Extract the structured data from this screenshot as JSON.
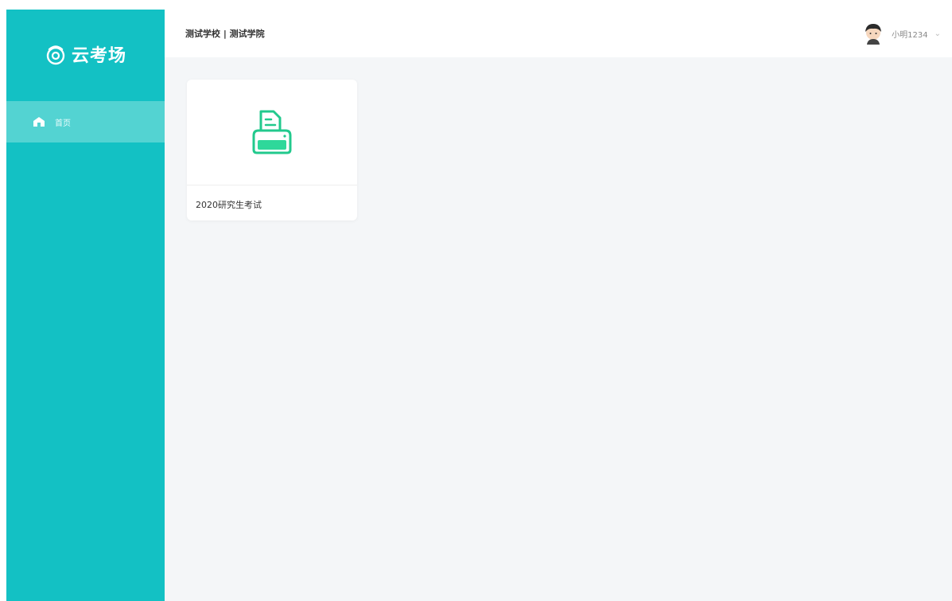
{
  "app": {
    "name": "云考场"
  },
  "sidebar": {
    "items": [
      {
        "label": "首页",
        "icon": "home-icon",
        "active": true
      }
    ]
  },
  "header": {
    "breadcrumb": "测试学校 | 测试学院",
    "user": {
      "name": "小明1234",
      "avatar": "avatar"
    }
  },
  "main": {
    "cards": [
      {
        "title": "2020研究生考试",
        "icon": "exam-printer-icon"
      }
    ]
  },
  "colors": {
    "sidebar": "#13c1c4",
    "sidebar_active": "#53d3d2",
    "accent_green": "#22c98d",
    "background": "#f4f6f8"
  }
}
